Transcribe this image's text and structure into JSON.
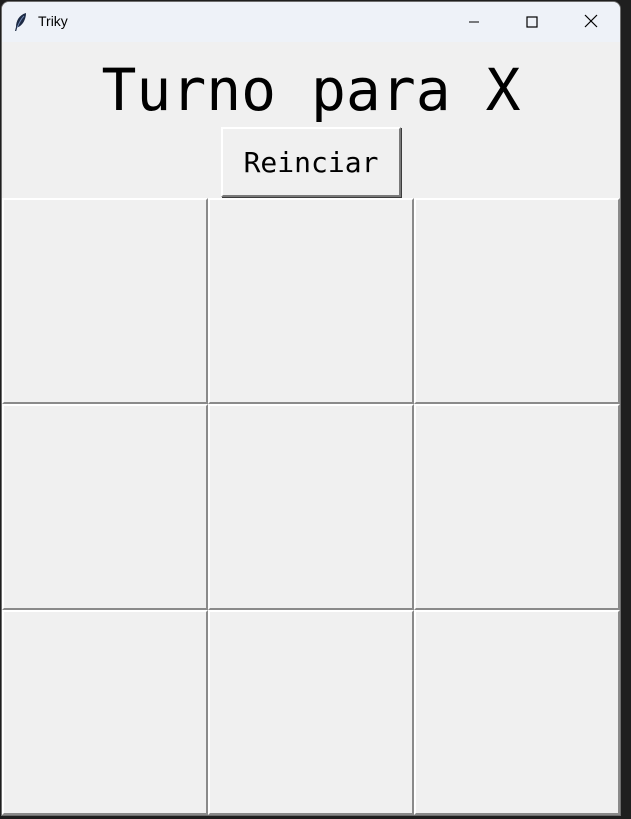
{
  "window": {
    "title": "Triky",
    "minimize_icon": "minimize-icon",
    "maximize_icon": "maximize-icon",
    "close_icon": "close-icon",
    "app_icon": "feather-icon"
  },
  "game": {
    "status": "Turno para X",
    "reset_label": "Reinciar",
    "board": [
      [
        "",
        "",
        ""
      ],
      [
        "",
        "",
        ""
      ],
      [
        "",
        "",
        ""
      ]
    ]
  }
}
